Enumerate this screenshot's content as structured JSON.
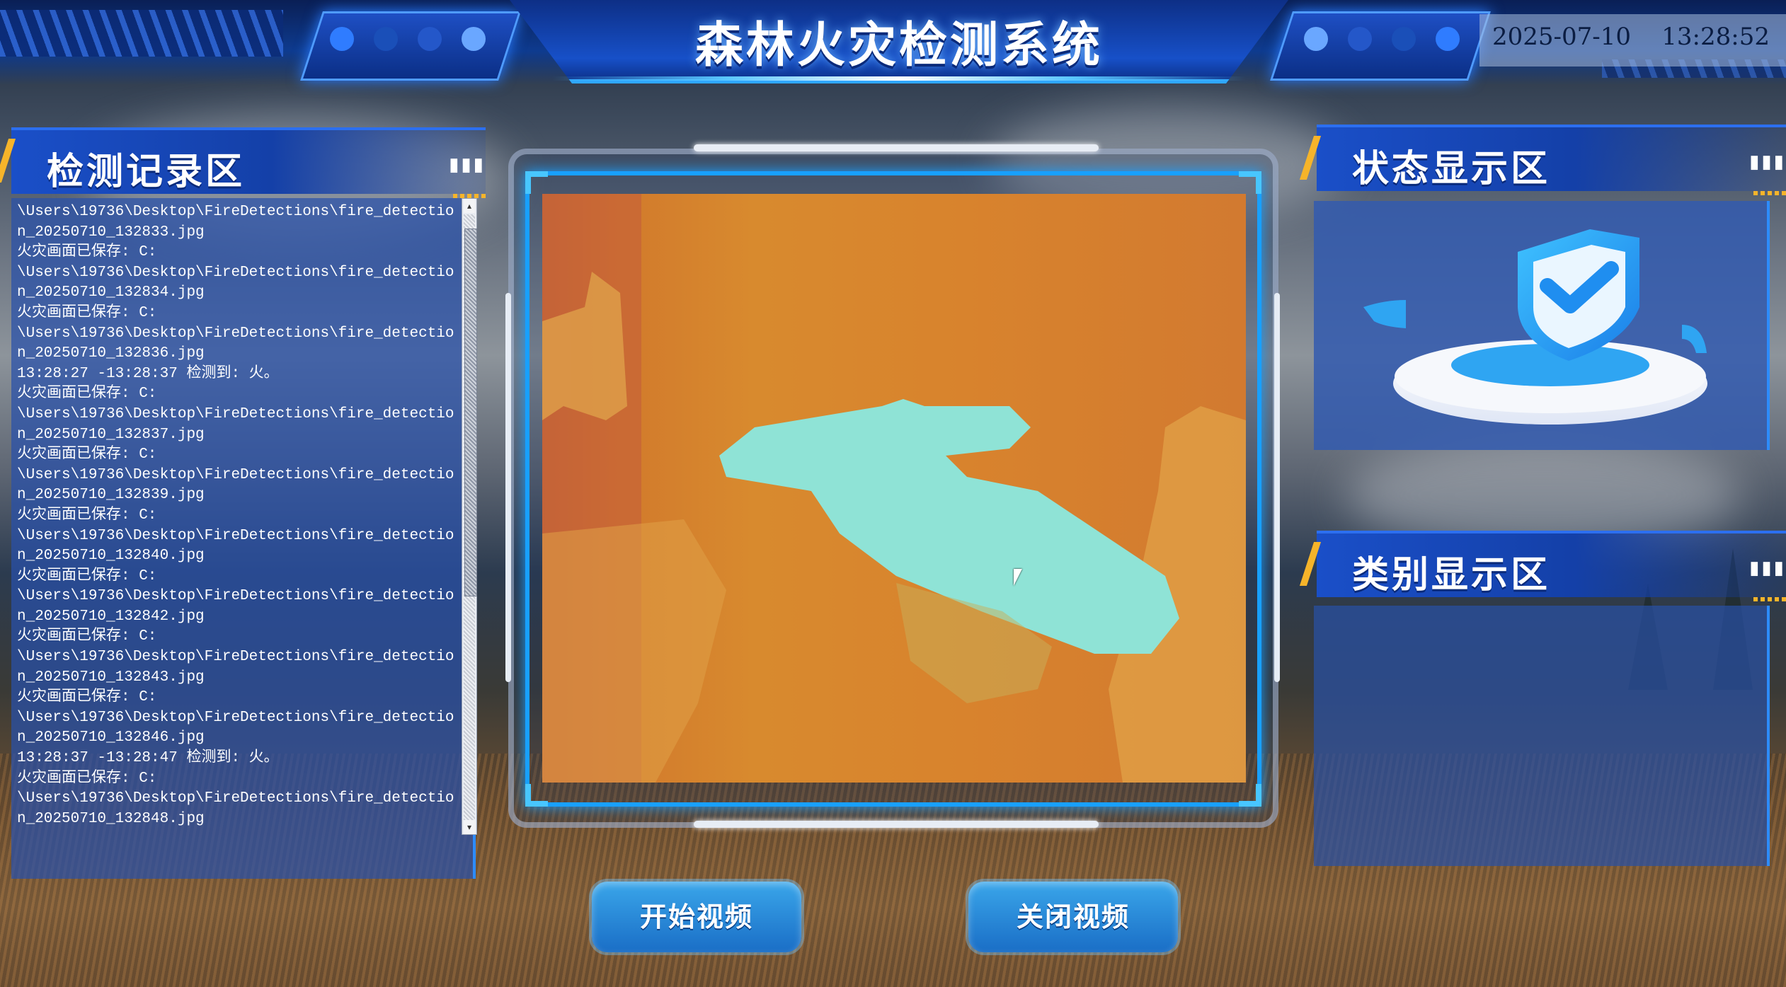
{
  "header": {
    "title": "森林火灾检测系统",
    "date": "2025-07-10",
    "time": "13:28:52"
  },
  "log_section": {
    "title": "检测记录区",
    "lines": [
      "\\Users\\19736\\Desktop\\FireDetections\\fire_detectio",
      "n_20250710_132833.jpg",
      "火灾画面已保存: C:",
      "\\Users\\19736\\Desktop\\FireDetections\\fire_detectio",
      "n_20250710_132834.jpg",
      "火灾画面已保存: C:",
      "\\Users\\19736\\Desktop\\FireDetections\\fire_detectio",
      "n_20250710_132836.jpg",
      "13:28:27 -13:28:37 检测到: 火。",
      "火灾画面已保存: C:",
      "\\Users\\19736\\Desktop\\FireDetections\\fire_detectio",
      "n_20250710_132837.jpg",
      "火灾画面已保存: C:",
      "\\Users\\19736\\Desktop\\FireDetections\\fire_detectio",
      "n_20250710_132839.jpg",
      "火灾画面已保存: C:",
      "\\Users\\19736\\Desktop\\FireDetections\\fire_detectio",
      "n_20250710_132840.jpg",
      "火灾画面已保存: C:",
      "\\Users\\19736\\Desktop\\FireDetections\\fire_detectio",
      "n_20250710_132842.jpg",
      "火灾画面已保存: C:",
      "\\Users\\19736\\Desktop\\FireDetections\\fire_detectio",
      "n_20250710_132843.jpg",
      "火灾画面已保存: C:",
      "\\Users\\19736\\Desktop\\FireDetections\\fire_detectio",
      "n_20250710_132846.jpg",
      "13:28:37 -13:28:47 检测到: 火。",
      "火灾画面已保存: C:",
      "\\Users\\19736\\Desktop\\FireDetections\\fire_detectio",
      "n_20250710_132848.jpg"
    ]
  },
  "status_section": {
    "title": "状态显示区",
    "icon": "shield-check-icon"
  },
  "category_section": {
    "title": "类别显示区"
  },
  "buttons": {
    "start_video": "开始视频",
    "stop_video": "关闭视频"
  },
  "colors": {
    "accent": "#18a0ff",
    "header": "#1750c8",
    "warning_stripe": "#f6b42a",
    "button": "#2a8ad8"
  }
}
